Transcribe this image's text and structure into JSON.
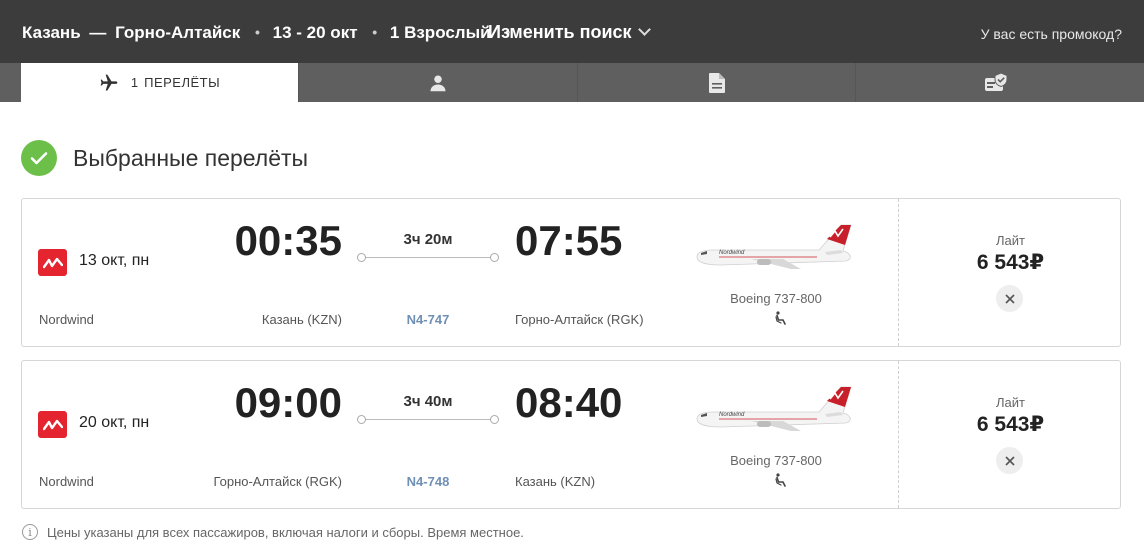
{
  "header": {
    "from": "Казань",
    "dash": "—",
    "to": "Горно-Алтайск",
    "dates": "13 - 20 окт",
    "passengers": "1 Взрослый",
    "separator": "•",
    "change_search": "Изменить поиск",
    "promo": "У вас есть промокод?"
  },
  "tabs": [
    {
      "number": "1",
      "label": "ПЕРЕЛЁТЫ",
      "icon": "airplane-icon",
      "active": true
    },
    {
      "icon": "person-icon",
      "active": false
    },
    {
      "icon": "document-icon",
      "active": false
    },
    {
      "icon": "ticket-check-icon",
      "active": false
    }
  ],
  "selected_title": "Выбранные перелёты",
  "flights": [
    {
      "date": "13 окт, пн",
      "airline": "Nordwind",
      "dep_time": "00:35",
      "duration": "3ч 20м",
      "arr_time": "07:55",
      "dep_airport": "Казань (KZN)",
      "flight_no": "N4-747",
      "arr_airport": "Горно-Алтайск (RGK)",
      "aircraft": "Boeing 737-800",
      "livery": "Nordwind",
      "fare": "Лайт",
      "price": "6 543₽"
    },
    {
      "date": "20 окт, пн",
      "airline": "Nordwind",
      "dep_time": "09:00",
      "duration": "3ч 40м",
      "arr_time": "08:40",
      "dep_airport": "Горно-Алтайск (RGK)",
      "flight_no": "N4-748",
      "arr_airport": "Казань (KZN)",
      "aircraft": "Boeing 737-800",
      "livery": "Nordwind",
      "fare": "Лайт",
      "price": "6 543₽"
    }
  ],
  "note": "Цены указаны для всех пассажиров, включая налоги и сборы. Время местное.",
  "colors": {
    "header_bg": "#3c3c3c",
    "tabs_bg": "#5f5f5f",
    "brand_red": "#e4242e",
    "check_green": "#6cc04a",
    "flight_no": "#6f8fb5"
  }
}
